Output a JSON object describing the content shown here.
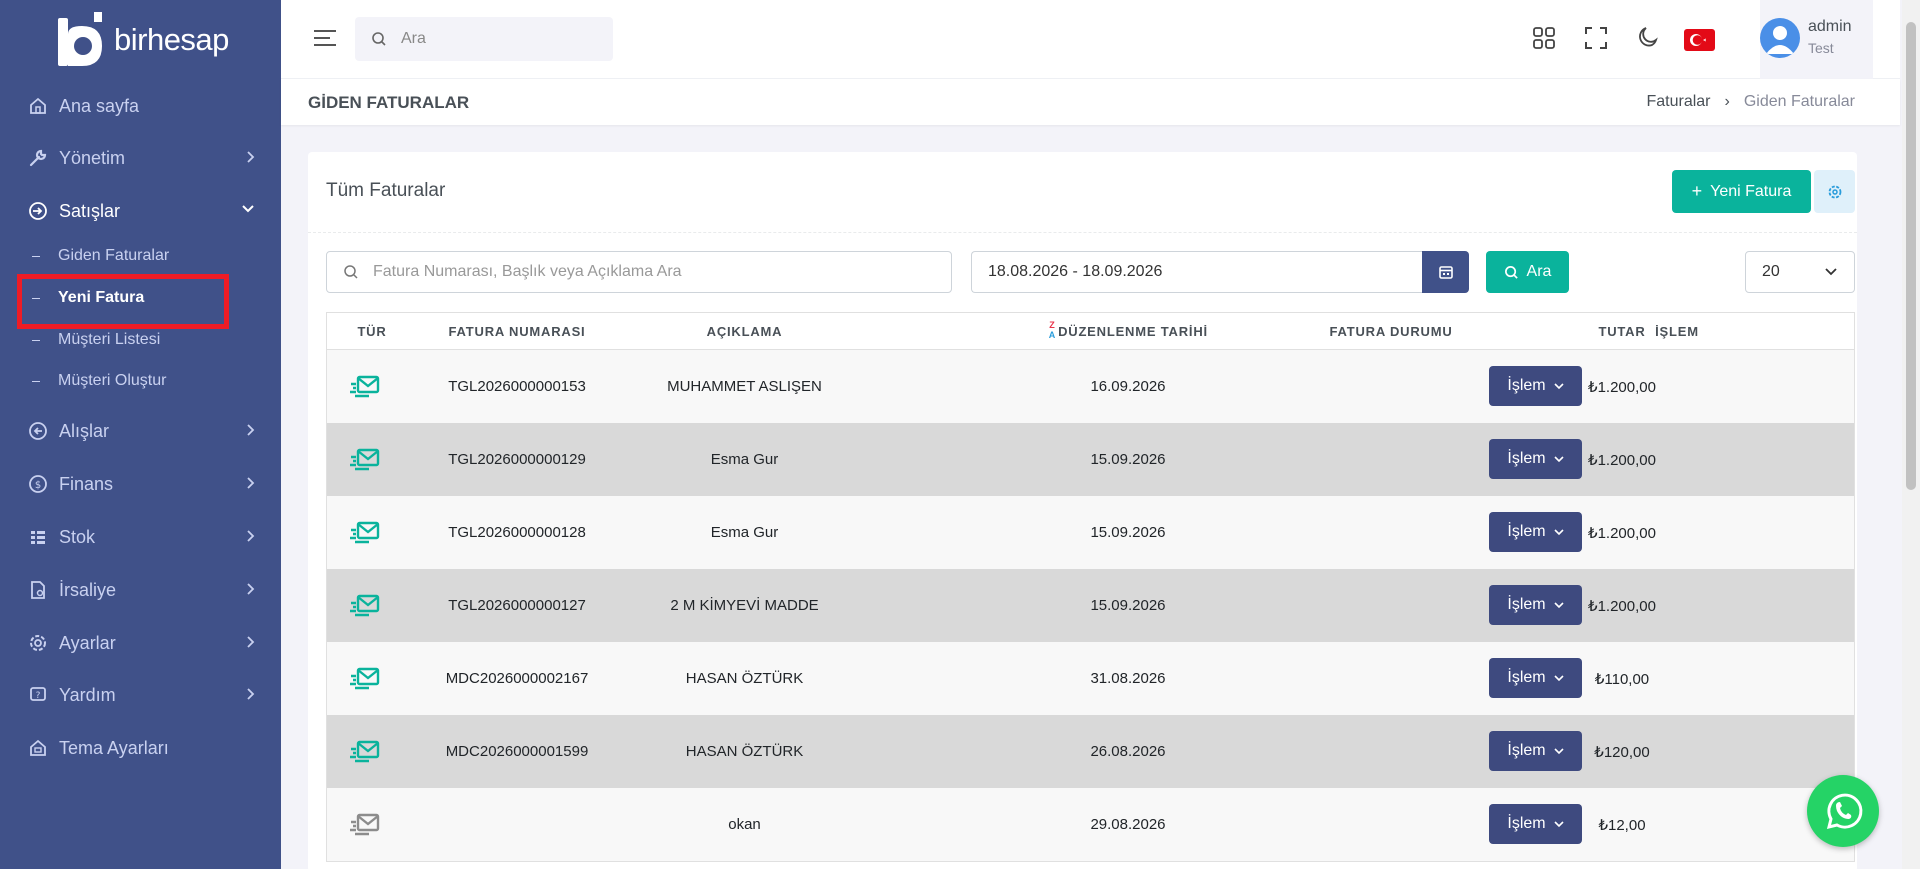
{
  "brand": {
    "name": "birhesap"
  },
  "sidebar": {
    "items": [
      {
        "label": "Ana sayfa",
        "icon": "home-icon"
      },
      {
        "label": "Yönetim",
        "icon": "wrench-icon"
      },
      {
        "label": "Satışlar",
        "icon": "sales-icon"
      },
      {
        "label": "Alışlar",
        "icon": "purchase-icon"
      },
      {
        "label": "Finans",
        "icon": "finance-icon"
      },
      {
        "label": "Stok",
        "icon": "stock-icon"
      },
      {
        "label": "İrsaliye",
        "icon": "waybill-icon"
      },
      {
        "label": "Ayarlar",
        "icon": "settings-icon"
      },
      {
        "label": "Yardım",
        "icon": "help-icon"
      },
      {
        "label": "Tema Ayarları",
        "icon": "theme-icon"
      }
    ],
    "sales_sub": [
      {
        "label": "Giden Faturalar"
      },
      {
        "label": "Yeni Fatura"
      },
      {
        "label": "Müşteri Listesi"
      },
      {
        "label": "Müşteri Oluştur"
      }
    ]
  },
  "topbar": {
    "search_placeholder": "Ara",
    "user_name": "admin",
    "user_role": "Test"
  },
  "page": {
    "title": "GİDEN FATURALAR",
    "breadcrumb": [
      "Faturalar",
      "Giden Faturalar"
    ],
    "breadcrumb_sep": "›"
  },
  "card": {
    "title": "Tüm Faturalar",
    "new_button": "Yeni Fatura",
    "search_placeholder": "Fatura Numarası, Başlık veya Açıklama Ara",
    "date_range": "18.08.2026 - 18.09.2026",
    "search_button": "Ara",
    "page_size": "20"
  },
  "table": {
    "columns": [
      "TÜR",
      "FATURA NUMARASI",
      "AÇIKLAMA",
      "DÜZENLENME TARİHİ",
      "FATURA DURUMU",
      "TUTAR",
      "İŞLEM"
    ],
    "sort_icon_letters": [
      "Z",
      "A"
    ],
    "action_label": "İşlem",
    "rows": [
      {
        "type": "sent",
        "number": "TGL2026000000153",
        "description": "MUHAMMET ASLIŞEN",
        "date": "16.09.2026",
        "status": "",
        "amount": "₺1.200,00"
      },
      {
        "type": "sent",
        "number": "TGL2026000000129",
        "description": "Esma Gur",
        "date": "15.09.2026",
        "status": "",
        "amount": "₺1.200,00"
      },
      {
        "type": "sent",
        "number": "TGL2026000000128",
        "description": "Esma Gur",
        "date": "15.09.2026",
        "status": "",
        "amount": "₺1.200,00"
      },
      {
        "type": "sent",
        "number": "TGL2026000000127",
        "description": "2 M KİMYEVİ MADDE",
        "date": "15.09.2026",
        "status": "",
        "amount": "₺1.200,00"
      },
      {
        "type": "sent",
        "number": "MDC2026000002167",
        "description": "HASAN ÖZTÜRK",
        "date": "31.08.2026",
        "status": "",
        "amount": "₺110,00"
      },
      {
        "type": "sent",
        "number": "MDC2026000001599",
        "description": "HASAN ÖZTÜRK",
        "date": "26.08.2026",
        "status": "",
        "amount": "₺120,00"
      },
      {
        "type": "draft",
        "number": "",
        "description": "okan",
        "date": "29.08.2026",
        "status": "",
        "amount": "₺12,00"
      }
    ]
  },
  "colors": {
    "sidebar": "#405189",
    "accent": "#0ab39c",
    "action": "#3e4a7f",
    "highlight": "#ee1c25"
  }
}
